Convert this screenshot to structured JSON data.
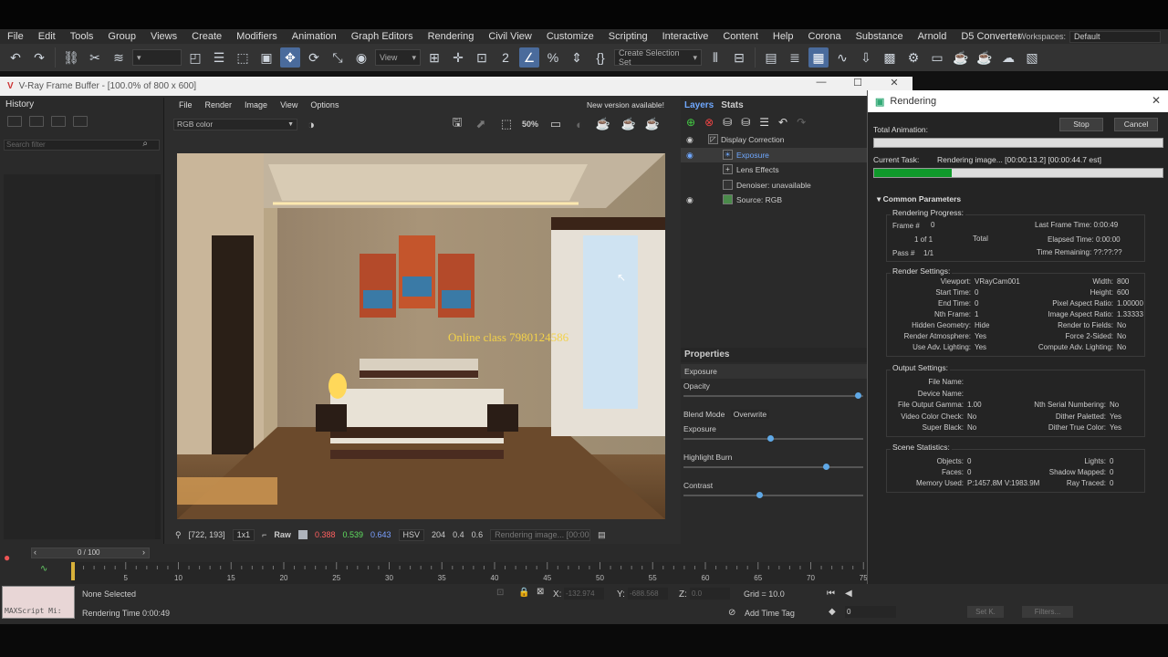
{
  "menubar": [
    "File",
    "Edit",
    "Tools",
    "Group",
    "Views",
    "Create",
    "Modifiers",
    "Animation",
    "Graph Editors",
    "Rendering",
    "Civil View",
    "Customize",
    "Scripting",
    "Interactive",
    "Content",
    "Help",
    "Corona",
    "Substance",
    "Arnold",
    "D5 Converter"
  ],
  "workspaces": {
    "label": "Workspaces:",
    "value": "Default"
  },
  "toolbar": {
    "view_dropdown": "View",
    "selection_set": "Create Selection Set"
  },
  "vfb": {
    "title": "V-Ray Frame Buffer - [100.0% of 800 x 600]",
    "history_title": "History",
    "search_placeholder": "Search filter",
    "menu": [
      "File",
      "Render",
      "Image",
      "View",
      "Options"
    ],
    "new_version": "New version available!",
    "channel": "RGB color",
    "zoom_label": "50%",
    "watermark": "Online class 7980124586",
    "status": {
      "coords": "[722, 193]",
      "zoom": "1x1",
      "raw": "Raw",
      "r": "0.388",
      "g": "0.539",
      "b": "0.643",
      "mode": "HSV",
      "h": "204",
      "s": "0.4",
      "v": "0.6",
      "progress": "Rendering image... [00:00..."
    }
  },
  "layers": {
    "tab_layers": "Layers",
    "tab_stats": "Stats",
    "items": [
      "Display Correction",
      "Exposure",
      "Lens Effects",
      "Denoiser: unavailable",
      "Source: RGB"
    ],
    "properties_title": "Properties",
    "selected": "Exposure",
    "opacity": "Opacity",
    "blend_mode_label": "Blend Mode",
    "blend_mode": "Overwrite",
    "exposure": "Exposure",
    "highlight_burn": "Highlight Burn",
    "contrast": "Contrast",
    "opacity_value": 0.99,
    "exposure_value": 0.5,
    "highlight_burn_value": 0.81,
    "contrast_value": 0.44
  },
  "rendering": {
    "title": "Rendering",
    "stop": "Stop",
    "cancel": "Cancel",
    "total_animation": "Total Animation:",
    "current_task_label": "Current Task:",
    "current_task": "Rendering image... [00:00:13.2] [00:00:44.7 est]",
    "current_progress": 0.27,
    "common_params": "Common Parameters",
    "rp_title": "Rendering Progress:",
    "frame_label": "Frame #",
    "frame": "0",
    "of": "1 of 1",
    "total": "Total",
    "pass_label": "Pass #",
    "pass": "1/1",
    "last_frame_label": "Last Frame Time:",
    "last_frame": "0:00:49",
    "elapsed_label": "Elapsed Time:",
    "elapsed": "0:00:00",
    "remaining_label": "Time Remaining:",
    "remaining": "??:??:??",
    "rs_title": "Render Settings:",
    "rs_left": [
      [
        "Viewport:",
        "VRayCam001"
      ],
      [
        "Start Time:",
        "0"
      ],
      [
        "End Time:",
        "0"
      ],
      [
        "Nth Frame:",
        "1"
      ],
      [
        "Hidden Geometry:",
        "Hide"
      ],
      [
        "Render Atmosphere:",
        "Yes"
      ],
      [
        "Use Adv. Lighting:",
        "Yes"
      ]
    ],
    "rs_right": [
      [
        "Width:",
        "800"
      ],
      [
        "Height:",
        "600"
      ],
      [
        "Pixel Aspect Ratio:",
        "1.00000"
      ],
      [
        "Image Aspect Ratio:",
        "1.33333"
      ],
      [
        "Render to Fields:",
        "No"
      ],
      [
        "Force 2-Sided:",
        "No"
      ],
      [
        "Compute Adv. Lighting:",
        "No"
      ]
    ],
    "os_title": "Output Settings:",
    "os_left": [
      [
        "File Name:",
        ""
      ],
      [
        "Device Name:",
        ""
      ],
      [
        "File Output Gamma:",
        "1.00"
      ],
      [
        "Video Color Check:",
        "No"
      ],
      [
        "Super Black:",
        "No"
      ]
    ],
    "os_right": [
      [
        "",
        ""
      ],
      [
        "",
        ""
      ],
      [
        "Nth Serial Numbering:",
        "No"
      ],
      [
        "Dither Paletted:",
        "Yes"
      ],
      [
        "Dither True Color:",
        "Yes"
      ]
    ],
    "ss_title": "Scene Statistics:",
    "ss_left": [
      [
        "Objects:",
        "0"
      ],
      [
        "Faces:",
        "0"
      ],
      [
        "Memory Used:",
        "P:1457.8M V:1983.9M"
      ]
    ],
    "ss_right": [
      [
        "Lights:",
        "0"
      ],
      [
        "Shadow Mapped:",
        "0"
      ],
      [
        "Ray Traced:",
        "0"
      ]
    ]
  },
  "timeline": {
    "frame_counter": "0 / 100",
    "ticks": [
      "5",
      "10",
      "15",
      "20",
      "25",
      "30",
      "35",
      "40",
      "45",
      "50",
      "55",
      "60",
      "65",
      "70",
      "75"
    ]
  },
  "status": {
    "maxscript": "MAXScript Mi:",
    "selection": "None Selected",
    "render_time": "Rendering Time  0:00:49",
    "x_label": "X:",
    "x": "-132.974",
    "y_label": "Y:",
    "y": "-688.568",
    "z_label": "Z:",
    "z": "0.0",
    "grid": "Grid = 10.0",
    "add_time_tag": "Add Time Tag",
    "set_key": "Set K.",
    "filters": "Filters...",
    "frame_field": "0"
  }
}
